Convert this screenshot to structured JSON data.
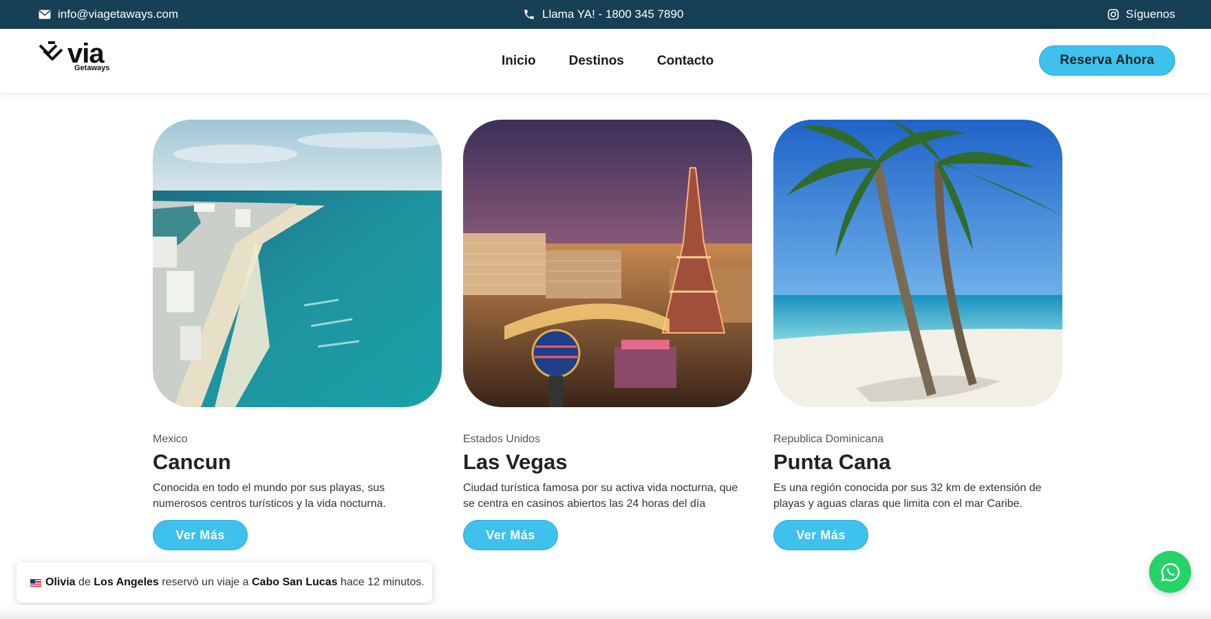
{
  "topbar": {
    "email": "info@viagetaways.com",
    "phone": "Llama YA! - 1800 345 7890",
    "social": "Síguenos",
    "icons": {
      "email": "envelope-icon",
      "phone": "phone-icon",
      "social": "instagram-icon"
    }
  },
  "logo": {
    "word": "via",
    "sub": "Getaways"
  },
  "nav": {
    "items": [
      {
        "label": "Inicio"
      },
      {
        "label": "Destinos"
      },
      {
        "label": "Contacto"
      }
    ]
  },
  "cta": {
    "label": "Reserva Ahora"
  },
  "destinations": [
    {
      "country": "Mexico",
      "city": "Cancun",
      "description": "Conocida en todo el mundo por sus playas, sus numerosos centros turísticos y la vida nocturna.",
      "button": "Ver Más"
    },
    {
      "country": "Estados Unidos",
      "city": "Las Vegas",
      "description": "Ciudad turística famosa por su activa vida nocturna, que se centra en casinos abiertos las 24 horas del día",
      "button": "Ver Más"
    },
    {
      "country": "Republica Dominicana",
      "city": "Punta Cana",
      "description": "Es una región conocida por sus 32 km de extensión de playas y aguas claras que limita con el mar Caribe.",
      "button": "Ver Más"
    }
  ],
  "toast": {
    "name": "Olivia",
    "t1": " de ",
    "origin": "Los Angeles",
    "t2": " reservó un viaje a ",
    "destination": "Cabo San Lucas",
    "t3": " hace 12 minutos."
  },
  "colors": {
    "topbar": "#173f55",
    "accent": "#3ec1ec",
    "whatsapp": "#25d366"
  }
}
